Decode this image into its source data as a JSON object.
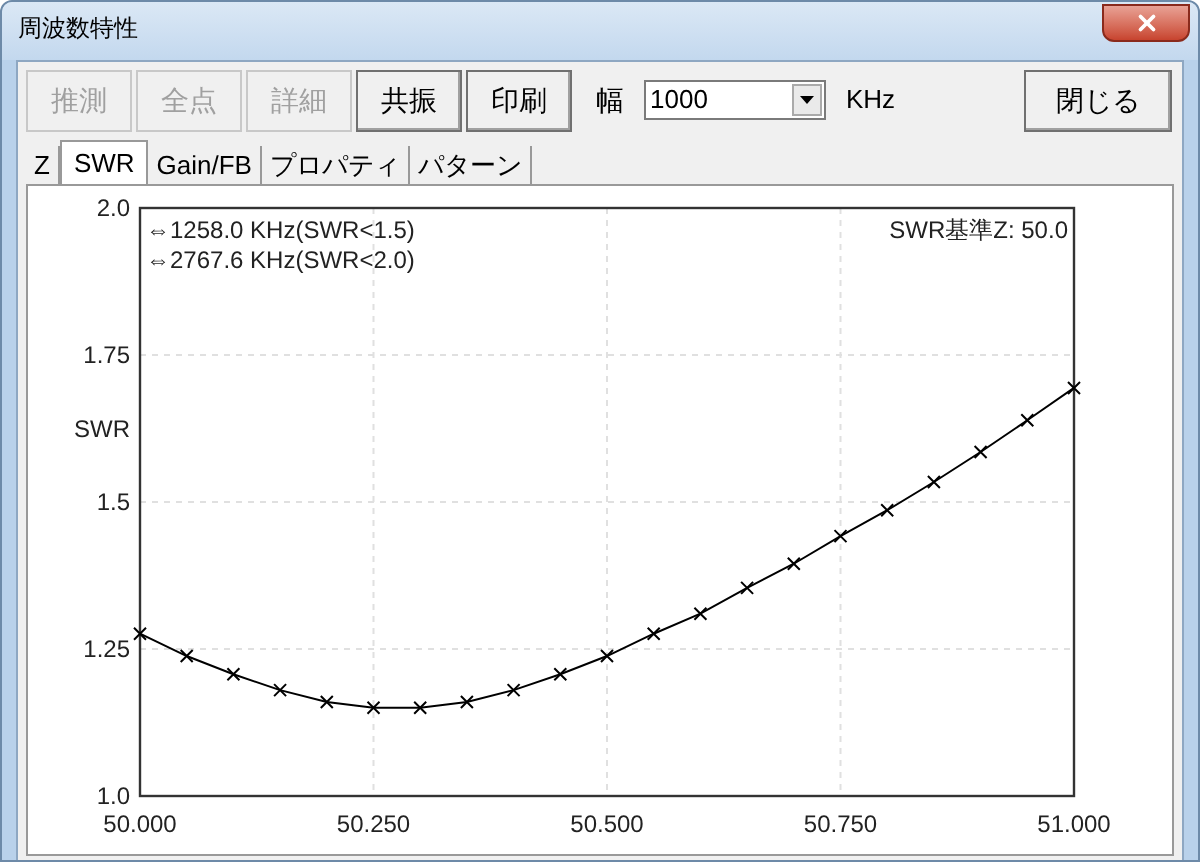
{
  "window": {
    "title": "周波数特性"
  },
  "toolbar": {
    "buttons": [
      {
        "label": "推測",
        "disabled": true
      },
      {
        "label": "全点",
        "disabled": true
      },
      {
        "label": "詳細",
        "disabled": true
      },
      {
        "label": "共振",
        "disabled": false
      },
      {
        "label": "印刷",
        "disabled": false
      }
    ],
    "width_label": "幅",
    "width_value": "1000",
    "unit": "KHz",
    "close_button": "閉じる"
  },
  "tabs": [
    {
      "label": "Z",
      "selected": false
    },
    {
      "label": "SWR",
      "selected": true
    },
    {
      "label": "Gain/FB",
      "selected": false
    },
    {
      "label": "プロパティ",
      "selected": false
    },
    {
      "label": "パターン",
      "selected": false
    }
  ],
  "chart": {
    "chart_data": {
      "type": "line",
      "ylabel": "SWR",
      "xlim": [
        50,
        51
      ],
      "ylim": [
        1,
        2
      ],
      "xticks": [
        {
          "value": 50,
          "label": "50.000"
        },
        {
          "value": 50.25,
          "label": "50.250"
        },
        {
          "value": 50.5,
          "label": "50.500"
        },
        {
          "value": 50.75,
          "label": "50.750"
        },
        {
          "value": 51,
          "label": "51.000"
        }
      ],
      "yticks": [
        {
          "value": 1,
          "label": "1.0"
        },
        {
          "value": 1.25,
          "label": "1.25"
        },
        {
          "value": 1.5,
          "label": "1.5"
        },
        {
          "value": 1.75,
          "label": "1.75"
        },
        {
          "value": 2,
          "label": "2.0"
        }
      ],
      "x": [
        50,
        50.05,
        50.1,
        50.15,
        50.2,
        50.25,
        50.3,
        50.35,
        50.4,
        50.45,
        50.5,
        50.55,
        50.6,
        50.65,
        50.7,
        50.75,
        50.8,
        50.85,
        50.9,
        50.95,
        51
      ],
      "grid": true,
      "series": [
        {
          "color": "#000000",
          "marker": "x",
          "values": [
            1.276,
            1.238,
            1.207,
            1.18,
            1.16,
            1.15,
            1.15,
            1.16,
            1.18,
            1.207,
            1.238,
            1.276,
            1.31,
            1.354,
            1.395,
            1.442,
            1.486,
            1.534,
            1.585,
            1.639,
            1.694
          ]
        }
      ],
      "annotations": [
        "⇔1258.0 KHz(SWR<1.5)",
        "⇔2767.6 KHz(SWR<2.0)"
      ]
    },
    "reference_impedance": "SWR基準Z: 50.0"
  }
}
